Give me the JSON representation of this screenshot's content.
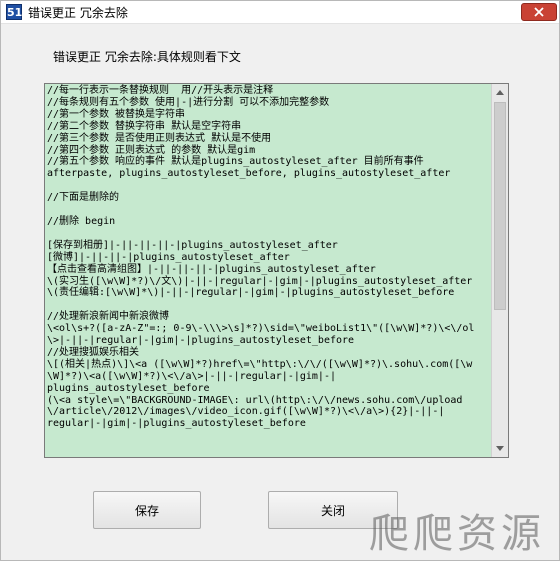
{
  "window": {
    "title": "错误更正 冗余去除",
    "app_icon_glyph": "51"
  },
  "header_label": "错误更正 冗余去除:具体规则看下文",
  "editor": {
    "background_color": "#c6e9cf",
    "lines": [
      "//每一行表示一条替换规则  用//开头表示是注释",
      "//每条规则有五个参数 使用|-|进行分割 可以不添加完整参数",
      "//第一个参数 被替换是字符串",
      "//第二个参数 替换字符串 默认是空字符串",
      "//第三个参数 是否使用正则表达式 默认是不使用",
      "//第四个参数 正则表达式 的参数 默认是gim",
      "//第五个参数 响应的事件 默认是plugins_autostyleset_after 目前所有事件",
      "afterpaste, plugins_autostyleset_before, plugins_autostyleset_after",
      "",
      "//下面是删除的",
      "",
      "//删除 begin",
      "",
      "[保存到相册]|-||-||-||-|plugins_autostyleset_after",
      "[微博]|-||-||-|plugins_autostyleset_after",
      "【点击查看高清组图】|-||-||-||-|plugins_autostyleset_after",
      "\\(实习生([\\w\\W]*?)\\/文\\)|-||-|regular|-|gim|-|plugins_autostyleset_after",
      "\\(责任编辑:[\\w\\W]*\\)|-||-|regular|-|gim|-|plugins_autostyleset_before",
      "",
      "//处理新浪新闻中新浪微博",
      "\\<ol\\s+?([a-zA-Z\"=:; 0-9\\-\\\\\\>\\s]*?)\\sid=\\\"weiboList1\\\"([\\w\\W]*?)\\<\\/ol",
      "\\>|-||-|regular|-|gim|-|plugins_autostyleset_before",
      "//处理搜狐娱乐相关",
      "\\[(相关|热点)\\]\\<a ([\\w\\W]*?)href\\=\\\"http\\:\\/\\/([\\w\\W]*?)\\.sohu\\.com([\\w",
      "\\W]*?)\\<a([\\w\\W]*?)\\<\\/a\\>|-||-|regular|-|gim|-|",
      "plugins_autostyleset_before",
      "(\\<a style\\=\\\"BACKGROUND-IMAGE\\: url\\(http\\:\\/\\/news.sohu.com\\/upload",
      "\\/article\\/2012\\/images\\/video_icon.gif([\\w\\W]*?)\\<\\/a\\>){2}|-||-|",
      "regular|-|gim|-|plugins_autostyleset_before"
    ]
  },
  "buttons": {
    "save": "保存",
    "close": "关闭"
  },
  "watermark": "爬爬资源"
}
